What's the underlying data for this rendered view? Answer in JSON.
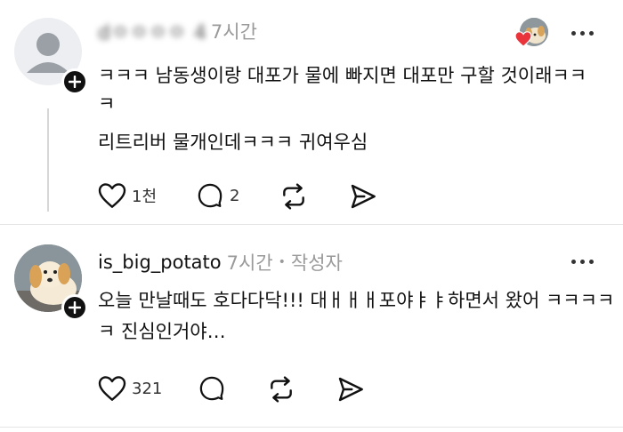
{
  "comment1": {
    "username": "dㅇㅇㅇㅇ 4",
    "timestamp": "7시간",
    "lines": [
      "ㅋㅋㅋ 남동생이랑 대포가 물에 빠지면 대포만 구할 것이래ㅋㅋ",
      "ㅋ",
      "리트리버 물개인데ㅋㅋㅋ 귀여우심"
    ],
    "like_count": "1천",
    "reply_count": "2"
  },
  "comment2": {
    "username": "is_big_potato",
    "timestamp": "7시간",
    "separator": "•",
    "author_badge": "작성자",
    "lines": [
      "오늘 만날때도 호다다닥!!! 대ㅐㅐㅐ포야ㅑㅑ하면서 왔어 ㅋㅋㅋㅋ",
      "ㅋ 진심인거야…"
    ],
    "like_count": "321"
  },
  "colors": {
    "text": "#111111",
    "meta": "#9a9a9a",
    "heart_red": "#e8343a",
    "thread_line": "#d7d7d7"
  },
  "icons": [
    "plus-icon",
    "heart-icon",
    "comment-icon",
    "repost-icon",
    "share-icon",
    "more-icon"
  ]
}
